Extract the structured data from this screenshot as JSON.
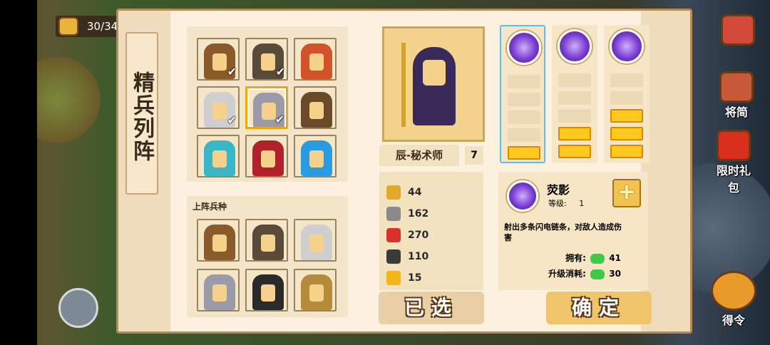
{
  "hud": {
    "troop_count": "30/34",
    "right_buttons": [
      {
        "label": "将简"
      },
      {
        "label": "限时礼包"
      },
      {
        "label": "得令"
      }
    ]
  },
  "panel": {
    "title": "精兵列阵",
    "unit_grid": [
      {
        "icon": "brawler-unit-icon",
        "selected": true,
        "color": "#8a5a2a"
      },
      {
        "icon": "rogue-unit-icon",
        "selected": true,
        "color": "#5a4a3a"
      },
      {
        "icon": "fire-hair-unit-icon",
        "selected": false,
        "color": "#d2532a"
      },
      {
        "icon": "white-hood-unit-icon",
        "selected": true,
        "color": "#cfcfcf"
      },
      {
        "icon": "sorcerer-unit-icon",
        "selected": true,
        "color": "#9a9aa8"
      },
      {
        "icon": "cannon-unit-icon",
        "selected": false,
        "color": "#6b4a2a"
      },
      {
        "icon": "dragon-unit-icon",
        "selected": false,
        "color": "#39b7c9"
      },
      {
        "icon": "red-knight-unit-icon",
        "selected": false,
        "color": "#b2202a"
      },
      {
        "icon": "blue-knight-unit-icon",
        "selected": false,
        "color": "#2a9be0"
      }
    ],
    "deployed_title": "上阵兵种",
    "deployed": [
      {
        "icon": "brawler-unit-icon",
        "color": "#8a5a2a"
      },
      {
        "icon": "rogue-unit-icon",
        "color": "#5a4a3a"
      },
      {
        "icon": "white-hood-unit-icon",
        "color": "#cfcfcf"
      },
      {
        "icon": "sorcerer-unit-icon",
        "color": "#9a9aa8"
      },
      {
        "icon": "black-knight-unit-icon",
        "color": "#2a2a2a"
      },
      {
        "icon": "lion-beast-unit-icon",
        "color": "#b58a3a"
      }
    ],
    "hero": {
      "name": "辰-秘术师",
      "level": "7",
      "stats": [
        {
          "icon": "sword-icon",
          "value": "44",
          "color": "#e3a92a"
        },
        {
          "icon": "shield-icon",
          "value": "162",
          "color": "#8a8a8a"
        },
        {
          "icon": "heart-icon",
          "value": "270",
          "color": "#d9322a"
        },
        {
          "icon": "boot-icon",
          "value": "110",
          "color": "#3a3a3a"
        },
        {
          "icon": "lightning-icon",
          "value": "15",
          "color": "#f4b51a"
        }
      ]
    },
    "skills": [
      {
        "icon": "dark-storm-skill-icon",
        "level": 1,
        "max": 5
      },
      {
        "icon": "dark-vortex-skill-icon",
        "level": 2,
        "max": 5
      },
      {
        "icon": "dark-moon-skill-icon",
        "level": 3,
        "max": 5
      }
    ],
    "skill_detail": {
      "name": "荧影",
      "level_label": "等级:",
      "level": "1",
      "description": "射出多条闪电链条，对敌人造成伤害",
      "owned_label": "拥有:",
      "owned": "41",
      "cost_label": "升级消耗:",
      "cost": "30"
    },
    "buttons": {
      "selected": "已选",
      "confirm": "确定"
    }
  }
}
